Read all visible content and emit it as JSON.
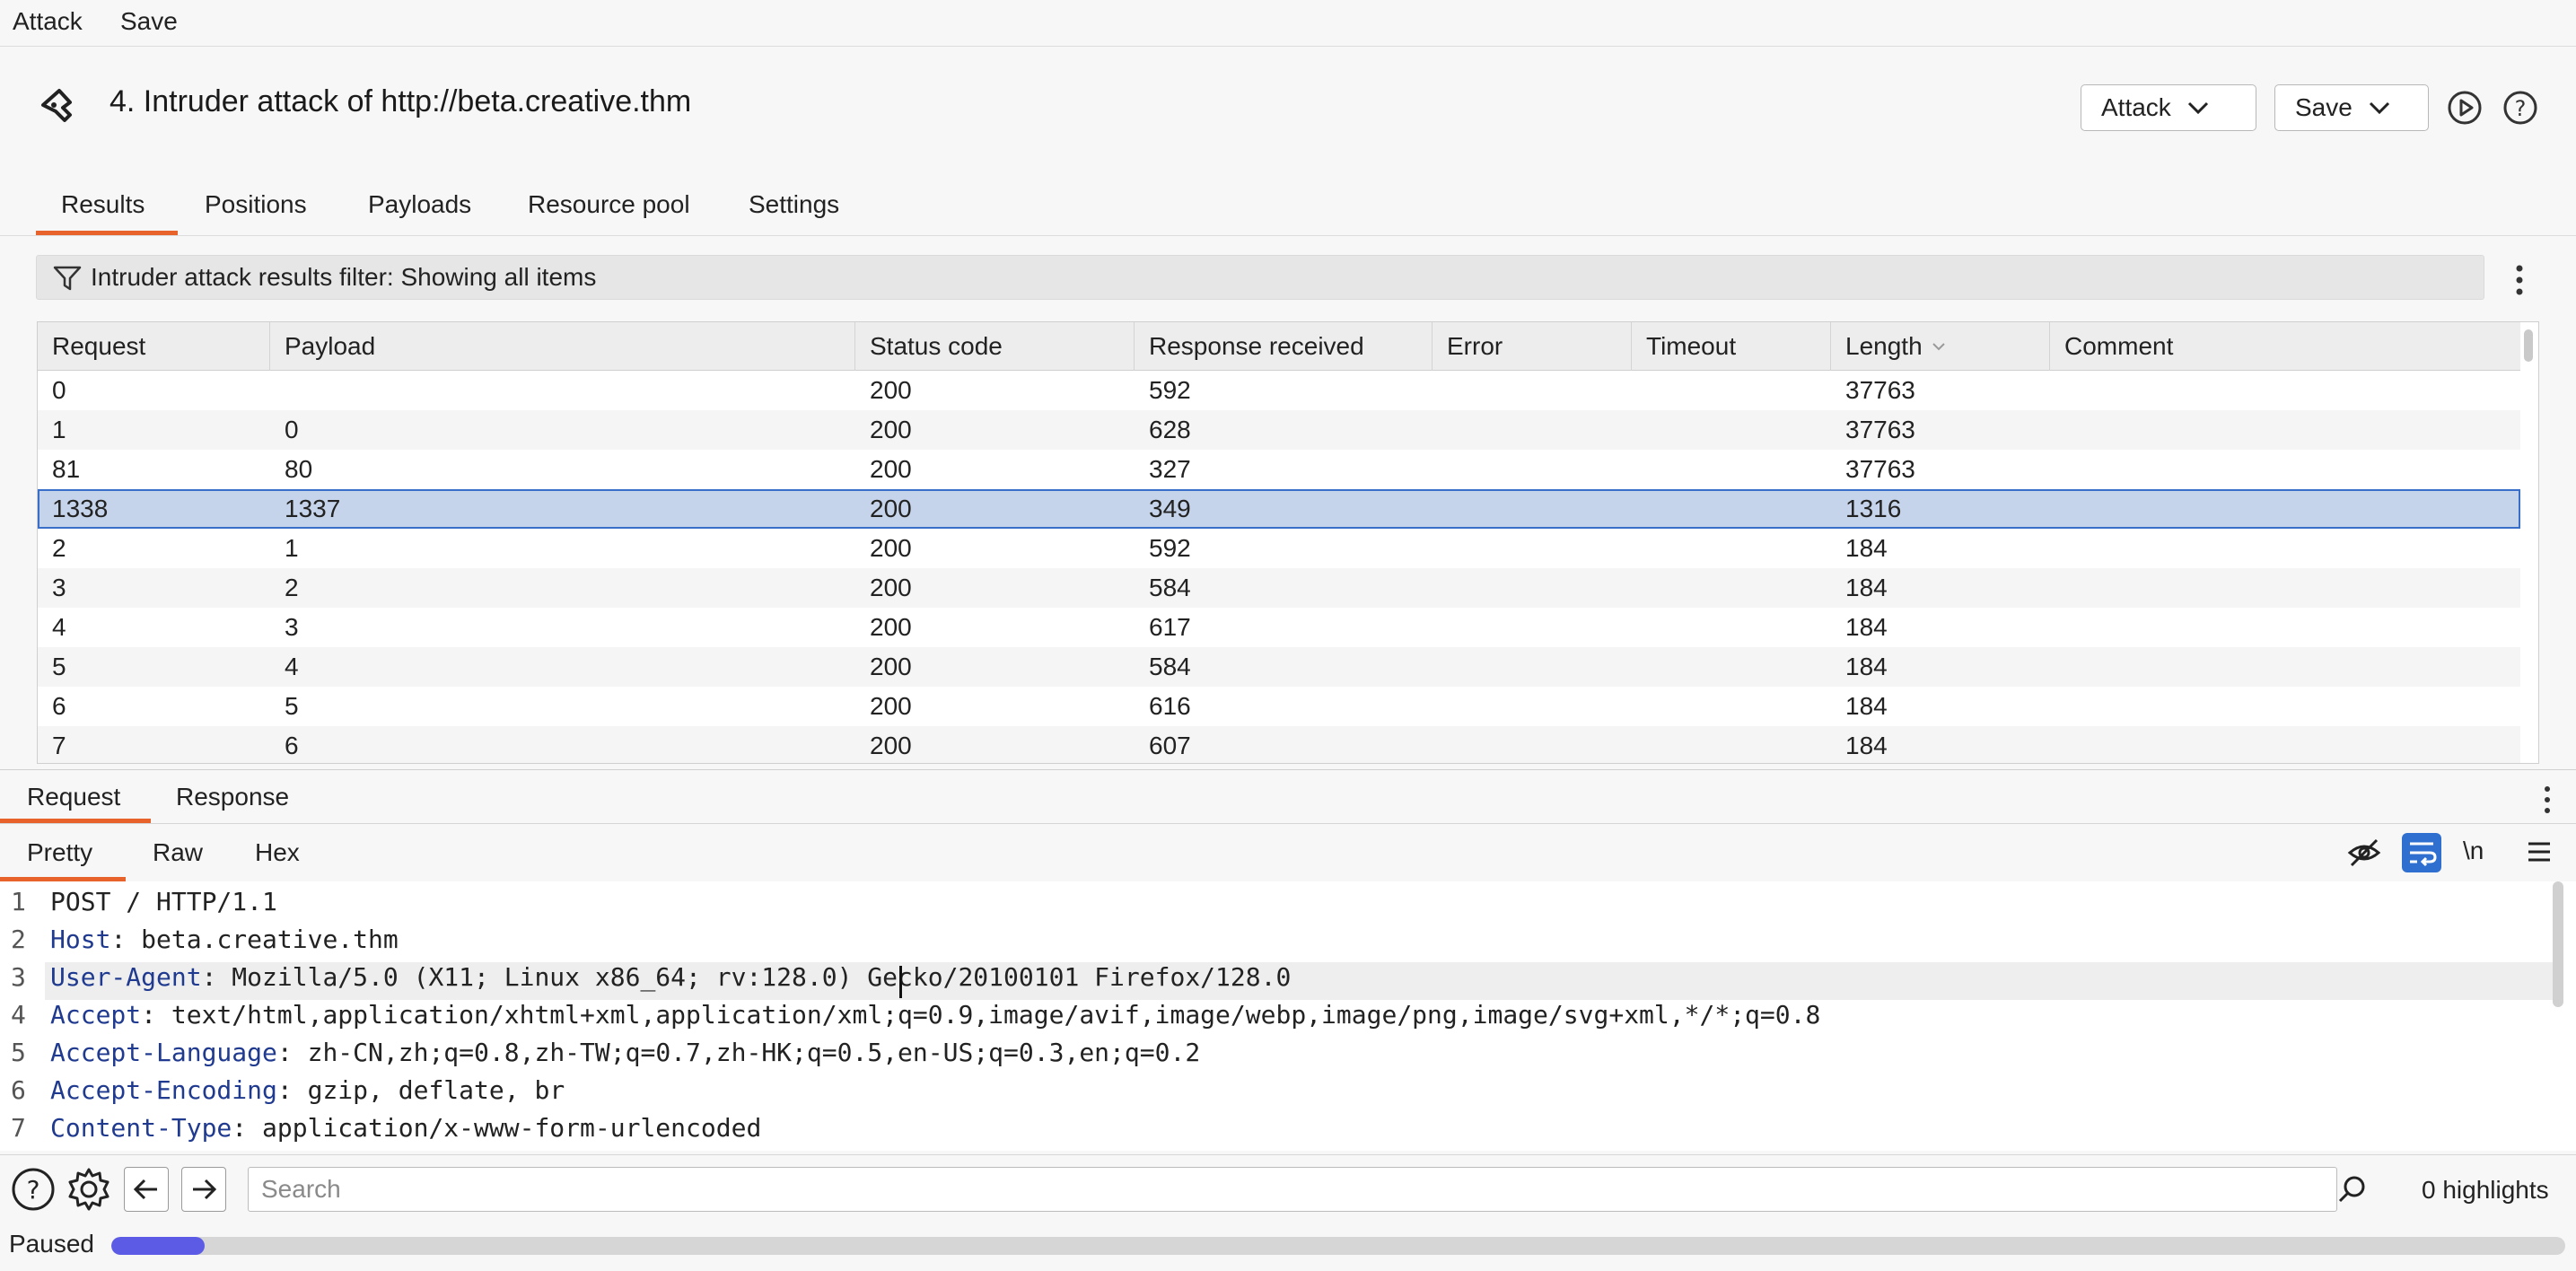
{
  "menu": {
    "attack": "Attack",
    "save": "Save"
  },
  "header": {
    "title": "4. Intruder attack of http://beta.creative.thm",
    "attack_button": "Attack",
    "save_button": "Save"
  },
  "tabs": [
    "Results",
    "Positions",
    "Payloads",
    "Resource pool",
    "Settings"
  ],
  "active_tab": "Results",
  "filter": {
    "text": "Intruder attack results filter: Showing all items"
  },
  "table": {
    "columns": [
      "Request",
      "Payload",
      "Status code",
      "Response received",
      "Error",
      "Timeout",
      "Length",
      "Comment"
    ],
    "rows": [
      [
        "0",
        "",
        "200",
        "592",
        "",
        "",
        "37763",
        ""
      ],
      [
        "1",
        "0",
        "200",
        "628",
        "",
        "",
        "37763",
        ""
      ],
      [
        "81",
        "80",
        "200",
        "327",
        "",
        "",
        "37763",
        ""
      ],
      [
        "1338",
        "1337",
        "200",
        "349",
        "",
        "",
        "1316",
        ""
      ],
      [
        "2",
        "1",
        "200",
        "592",
        "",
        "",
        "184",
        ""
      ],
      [
        "3",
        "2",
        "200",
        "584",
        "",
        "",
        "184",
        ""
      ],
      [
        "4",
        "3",
        "200",
        "617",
        "",
        "",
        "184",
        ""
      ],
      [
        "5",
        "4",
        "200",
        "584",
        "",
        "",
        "184",
        ""
      ],
      [
        "6",
        "5",
        "200",
        "616",
        "",
        "",
        "184",
        ""
      ],
      [
        "7",
        "6",
        "200",
        "607",
        "",
        "",
        "184",
        ""
      ]
    ],
    "selected_row": 3,
    "sorted_column": "Length"
  },
  "detail": {
    "tabs": [
      "Request",
      "Response"
    ],
    "view_tabs": [
      "Pretty",
      "Raw",
      "Hex"
    ],
    "newline_toggle": "\\n",
    "lines": [
      {
        "num": "1",
        "key": "",
        "value": "POST / HTTP/1.1"
      },
      {
        "num": "2",
        "key": "Host",
        "value": "beta.creative.thm"
      },
      {
        "num": "3",
        "key": "User-Agent",
        "value": "Mozilla/5.0 (X11; Linux x86_64; rv:128.0) Gecko/20100101 Firefox/128.0"
      },
      {
        "num": "4",
        "key": "Accept",
        "value": "text/html,application/xhtml+xml,application/xml;q=0.9,image/avif,image/webp,image/png,image/svg+xml,*/*;q=0.8"
      },
      {
        "num": "5",
        "key": "Accept-Language",
        "value": "zh-CN,zh;q=0.8,zh-TW;q=0.7,zh-HK;q=0.5,en-US;q=0.3,en;q=0.2"
      },
      {
        "num": "6",
        "key": "Accept-Encoding",
        "value": "gzip, deflate, br"
      },
      {
        "num": "7",
        "key": "Content-Type",
        "value": "application/x-www-form-urlencoded"
      }
    ]
  },
  "search": {
    "placeholder": "Search",
    "highlights": "0 highlights"
  },
  "status": {
    "text": "Paused",
    "progress_fraction": 0.038
  },
  "colors": {
    "accent": "#e8632b",
    "selection": "#c5d4ea",
    "progress": "#5b5be6",
    "header_key": "#1f3a8f"
  }
}
